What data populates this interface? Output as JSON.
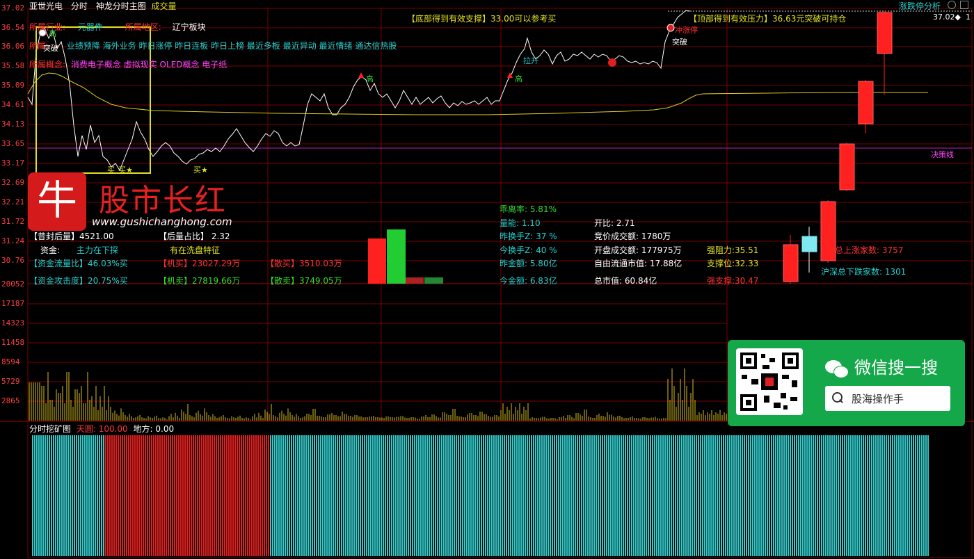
{
  "header": {
    "stock_name": "亚世光电",
    "mode": "分时",
    "chart_title": "神龙分时主图",
    "volume_label": "成交量",
    "right_button": "涨跌停分析",
    "price_readout": "37.02◆",
    "page_indicator": "1"
  },
  "industry": {
    "industry_label": "所属行业:",
    "industry_value": "元器件",
    "region_label": "所属地区:",
    "region_value": "辽宁板块",
    "flags_label": "所属",
    "flags_value": "业绩预降 海外业务 昨日涨停 昨日连板 昨日上榜 最近多板 最近异动 最近情绪 通达信热股",
    "concept_label": "所属概念:",
    "concept_value": "消费电子概念 虚拟现实 OLED概念 电子纸"
  },
  "annotations": {
    "bottom_support": "【底部得到有效支撑】33.00可以参考买",
    "top_pressure": "【顶部得到有效压力】36.63元突破可持仓",
    "high1": "高",
    "breakthrough1": "突破",
    "high2": "高",
    "high3": "高",
    "pull_up": "拉升",
    "limit_up": "冲涨停",
    "breakthrough2": "突破",
    "buy1": "买",
    "buy2": "买★",
    "buy3": "买★",
    "decision_line": "决策线"
  },
  "price_axis": [
    "37.02",
    "36.54",
    "36.06",
    "35.58",
    "35.09",
    "34.61",
    "34.13",
    "33.65",
    "33.17",
    "32.69",
    "32.21",
    "31.72",
    "31.24",
    "30.76"
  ],
  "volume_axis": [
    "20052",
    "17187",
    "14323",
    "11458",
    "8594",
    "5729",
    "2865"
  ],
  "stats_left": {
    "after_vol_label": "【昔封后量】",
    "after_vol_value": "4521.00",
    "after_ratio_label": "【后量占比】",
    "after_ratio_value": "2.32",
    "fund_label": "资金:",
    "fund_value": "主力在下探",
    "wash_value": "有在洗盘特征",
    "flow_label": "【资金流量比】",
    "flow_value": "46.03%买",
    "inst_buy_label": "【机买】",
    "inst_buy_value": "23027.29万",
    "retail_buy_label": "【散买】",
    "retail_buy_value": "3510.03万",
    "attack_label": "【资金攻击度】",
    "attack_value": "20.75%买",
    "inst_sell_label": "【机卖】",
    "inst_sell_value": "27819.66万",
    "retail_sell_label": "【散卖】",
    "retail_sell_value": "3749.05万"
  },
  "stats_mid": {
    "deviation": "乖离率: 5.81%",
    "vol_ratio": "量能: 1.10",
    "open_ratio": "开比: 2.71",
    "prev_turnover": "昨换手Z: 37 %",
    "auction_amount": "竞价成交额: 1780万",
    "today_turnover": "今换手Z: 40 %",
    "open_amount": "开盘成交额: 177975万",
    "resistance": "强阻力:35.51",
    "prev_amount": "昨金额: 5.80亿",
    "float_cap": "自由流通市值: 17.88亿",
    "support": "支撑位:32.33",
    "today_amount": "今金额: 6.83亿",
    "total_cap": "总市值: 60.84亿",
    "strong_support": "强支撑:30.47",
    "up_count": "总上涨家数: 3757",
    "down_count": "沪深总下跌家数: 1301"
  },
  "mining": {
    "title": "分时挖矿图",
    "sky_label": "天圆: 100.00",
    "earth_label": "地方: 0.00"
  },
  "logo": {
    "brand": "股市长红",
    "char": "牛",
    "url": "www.gushichanghong.com"
  },
  "wechat": {
    "title": "微信搜一搜",
    "search_text": "股海操作手"
  },
  "colors": {
    "up": "#ff2020",
    "down": "#20cc40",
    "price_line": "#ffffff",
    "avg_line": "#e0d020",
    "mining_cyan": "#35c8c8",
    "mining_red": "#e02020",
    "grid": "#7a0000"
  }
}
